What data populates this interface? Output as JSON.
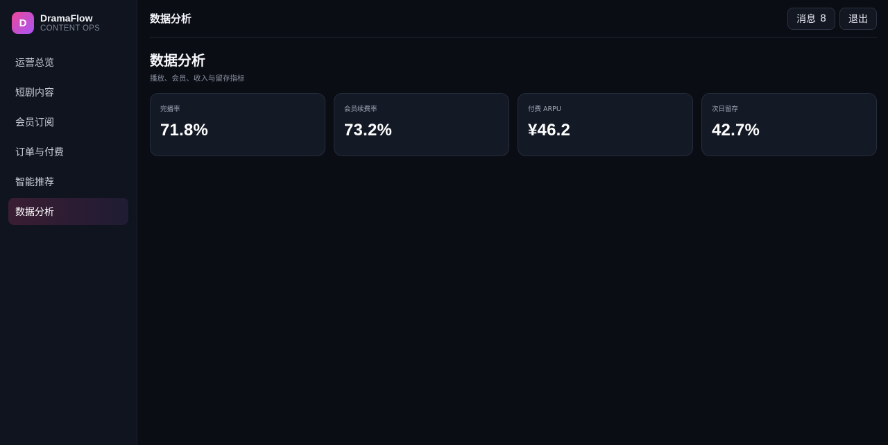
{
  "brand": {
    "logo_letter": "D",
    "name": "DramaFlow",
    "subtitle": "CONTENT OPS",
    "gradient": [
      "#ec4899",
      "#a855f7"
    ]
  },
  "sidebar": {
    "items": [
      {
        "label": "运营总览",
        "active": false
      },
      {
        "label": "短剧内容",
        "active": false
      },
      {
        "label": "会员订阅",
        "active": false
      },
      {
        "label": "订单与付费",
        "active": false
      },
      {
        "label": "智能推荐",
        "active": false
      },
      {
        "label": "数据分析",
        "active": true
      }
    ]
  },
  "topbar": {
    "title": "数据分析",
    "messages_label": "消息",
    "messages_count": "8",
    "logout_label": "退出"
  },
  "page": {
    "title": "数据分析",
    "subtitle": "播放、会员、收入与留存指标"
  },
  "metrics": [
    {
      "label": "完播率",
      "value": "71.8%"
    },
    {
      "label": "会员续费率",
      "value": "73.2%"
    },
    {
      "label": "付费 ARPU",
      "value": "¥46.2"
    },
    {
      "label": "次日留存",
      "value": "42.7%"
    }
  ],
  "colors": {
    "background": "#0a0d14",
    "sidebar": "#0f141e",
    "card": "#131925",
    "accent": "#ec4899"
  }
}
